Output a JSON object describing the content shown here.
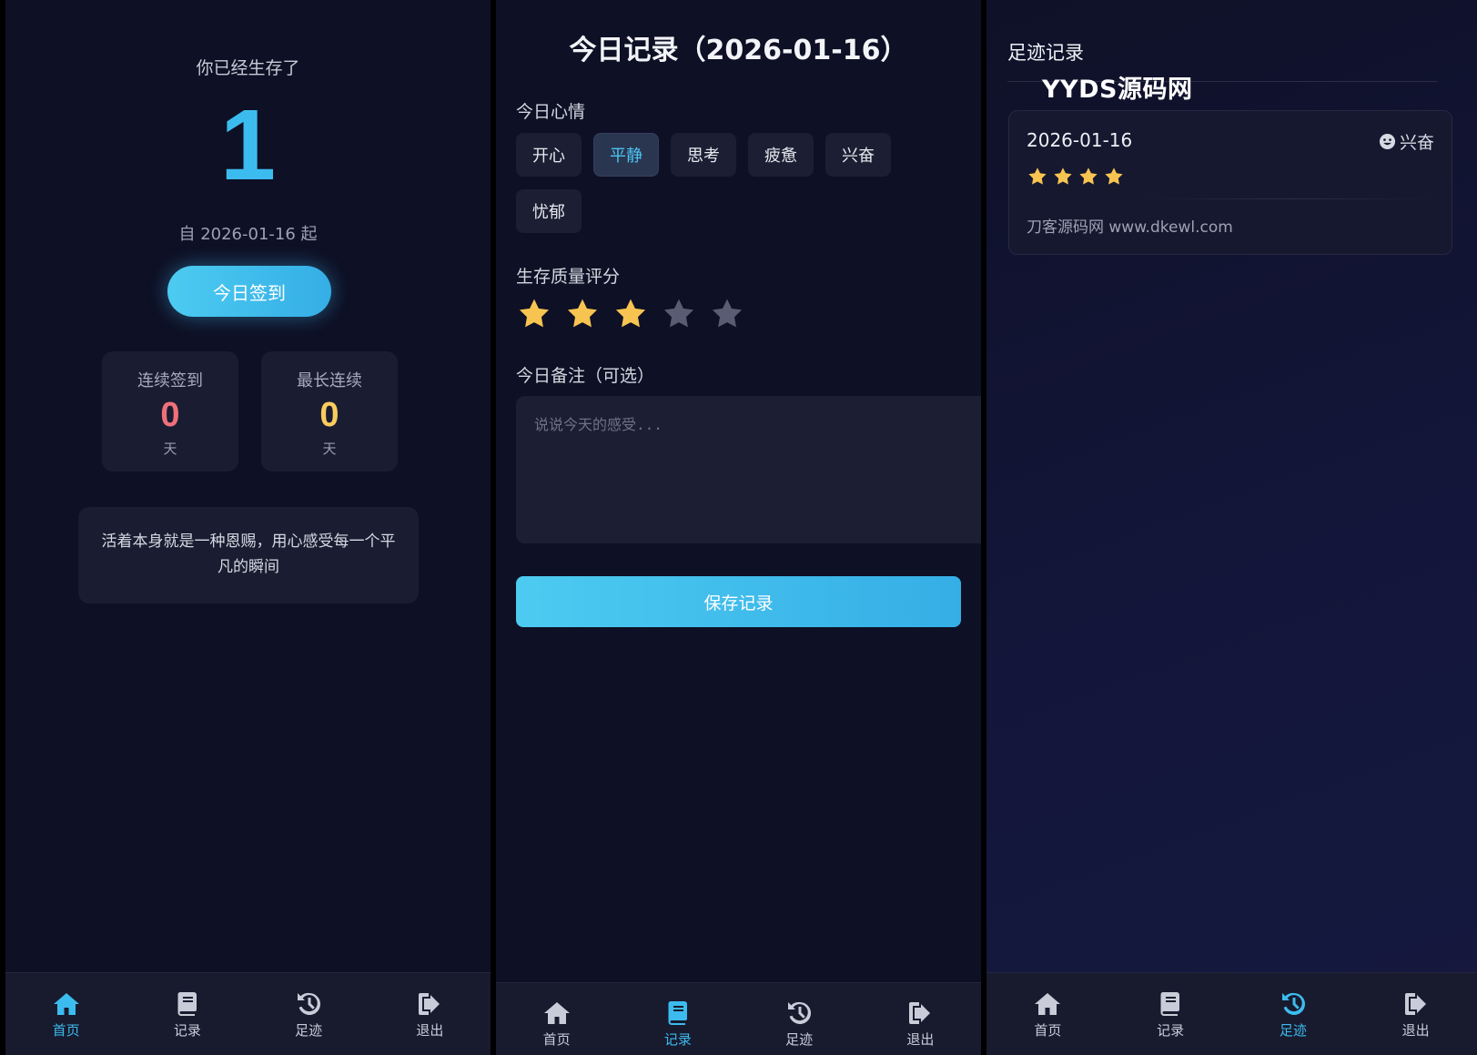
{
  "nav": {
    "items": [
      {
        "label": "首页",
        "icon": "home-icon"
      },
      {
        "label": "记录",
        "icon": "book-icon"
      },
      {
        "label": "足迹",
        "icon": "history-icon"
      },
      {
        "label": "退出",
        "icon": "logout-icon"
      }
    ],
    "accent": "#3cbcee"
  },
  "home": {
    "survive_label": "你已经生存了",
    "days": "1",
    "since": "自 2026-01-16 起",
    "checkin_button": "今日签到",
    "stats": {
      "continuous": {
        "label": "连续签到",
        "value": "0",
        "unit": "天",
        "color": "#f0707a"
      },
      "longest": {
        "label": "最长连续",
        "value": "0",
        "unit": "天",
        "color": "#f8cd5e"
      }
    },
    "quote": "活着本身就是一种恩赐，用心感受每一个平凡的瞬间",
    "active_tab": "首页"
  },
  "record": {
    "title": "今日记录（2026-01-16）",
    "mood_label": "今日心情",
    "moods": [
      "开心",
      "平静",
      "思考",
      "疲惫",
      "兴奋",
      "忧郁"
    ],
    "selected_mood": "平静",
    "rating_label": "生存质量评分",
    "rating": 3,
    "rating_max": 5,
    "note_label": "今日备注（可选）",
    "note_placeholder": "说说今天的感受...",
    "note_value": "",
    "save_button": "保存记录",
    "active_tab": "记录"
  },
  "footprints": {
    "title": "足迹记录",
    "watermark": "YYDS源码网",
    "entries": [
      {
        "date": "2026-01-16",
        "mood": "兴奋",
        "mood_icon": "smile-icon",
        "stars": 4,
        "note": "刀客源码网 www.dkewl.com"
      }
    ],
    "active_tab": "足迹"
  }
}
